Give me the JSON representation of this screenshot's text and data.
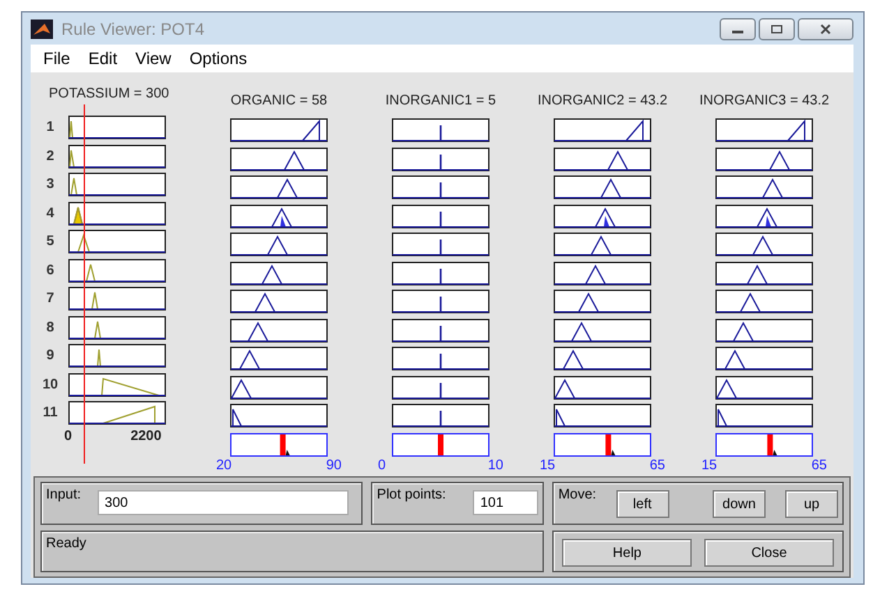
{
  "window": {
    "title": "Rule Viewer: POT4"
  },
  "menu": [
    "File",
    "Edit",
    "View",
    "Options"
  ],
  "rules": [
    {
      "label": "1",
      "fired": false
    },
    {
      "label": "2",
      "fired": false
    },
    {
      "label": "3",
      "fired": false
    },
    {
      "label": "4",
      "fired": true
    },
    {
      "label": "5",
      "fired": false
    },
    {
      "label": "6",
      "fired": false
    },
    {
      "label": "7",
      "fired": false
    },
    {
      "label": "8",
      "fired": false
    },
    {
      "label": "9",
      "fired": false
    },
    {
      "label": "10",
      "fired": false
    },
    {
      "label": "11",
      "fired": false
    }
  ],
  "variables": [
    {
      "kind": "input",
      "title": "POTASSIUM = 300",
      "min": "0",
      "max": "2200"
    },
    {
      "kind": "output",
      "title": "ORGANIC = 58",
      "min": "20",
      "max": "90",
      "level": 0.54
    },
    {
      "kind": "constant",
      "title": "INORGANIC1 = 5",
      "min": "0",
      "max": "10",
      "level": 0.5
    },
    {
      "kind": "output",
      "title": "INORGANIC2 = 43.2",
      "min": "15",
      "max": "65",
      "level": 0.56
    },
    {
      "kind": "output",
      "title": "INORGANIC3 = 43.2",
      "min": "15",
      "max": "65",
      "level": 0.56
    }
  ],
  "input": {
    "label": "Input:",
    "value": "300"
  },
  "plot_points": {
    "label": "Plot points:",
    "value": "101"
  },
  "move": {
    "label": "Move:",
    "buttons": [
      "left",
      "down",
      "up"
    ]
  },
  "status": "Ready",
  "buttons": [
    "Help",
    "Close"
  ]
}
